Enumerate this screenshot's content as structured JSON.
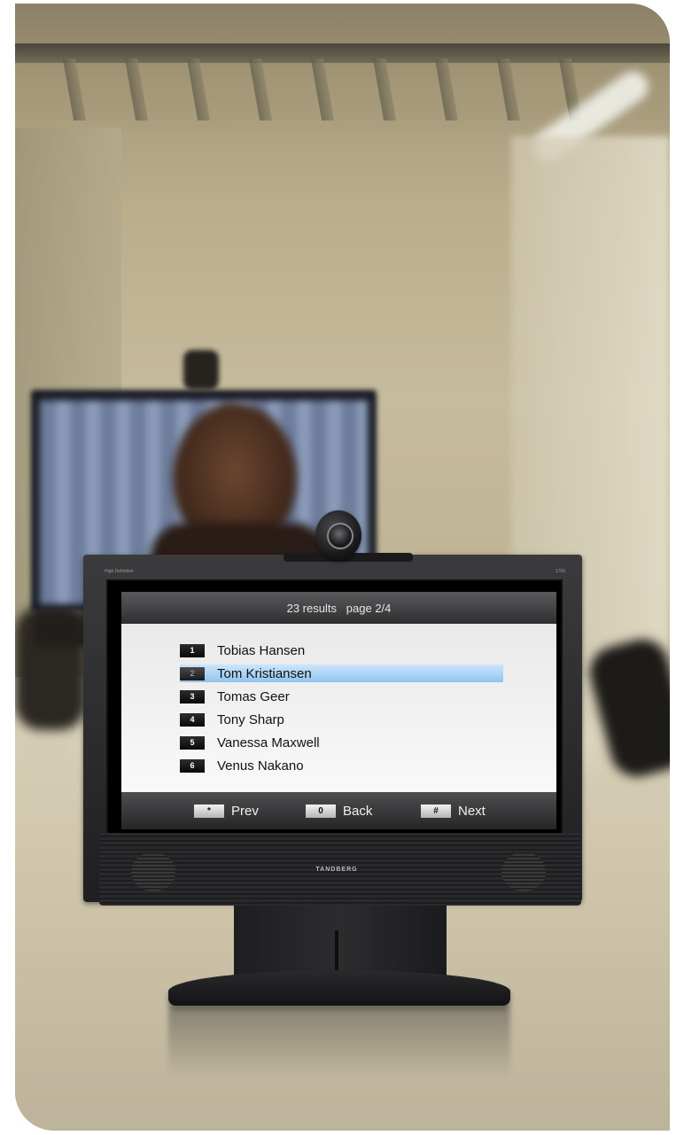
{
  "screen": {
    "header": "23 results   page 2/4",
    "results": [
      {
        "key": "1",
        "name": "Tobias Hansen",
        "selected": false
      },
      {
        "key": "2",
        "name": "Tom Kristiansen",
        "selected": true
      },
      {
        "key": "3",
        "name": "Tomas Geer",
        "selected": false
      },
      {
        "key": "4",
        "name": "Tony Sharp",
        "selected": false
      },
      {
        "key": "5",
        "name": "Vanessa Maxwell",
        "selected": false
      },
      {
        "key": "6",
        "name": "Venus Nakano",
        "selected": false
      }
    ],
    "footer": {
      "prev": {
        "key": "*",
        "label": "Prev"
      },
      "back": {
        "key": "0",
        "label": "Back"
      },
      "next": {
        "key": "#",
        "label": "Next"
      }
    }
  },
  "monitor": {
    "brand": "TANDBERG",
    "model": "1700",
    "badge_text": "High Definition"
  },
  "colors": {
    "selection": "#8fc3ef",
    "bezel": "#2a2a2c",
    "list_bg": "#f5f5f5"
  }
}
